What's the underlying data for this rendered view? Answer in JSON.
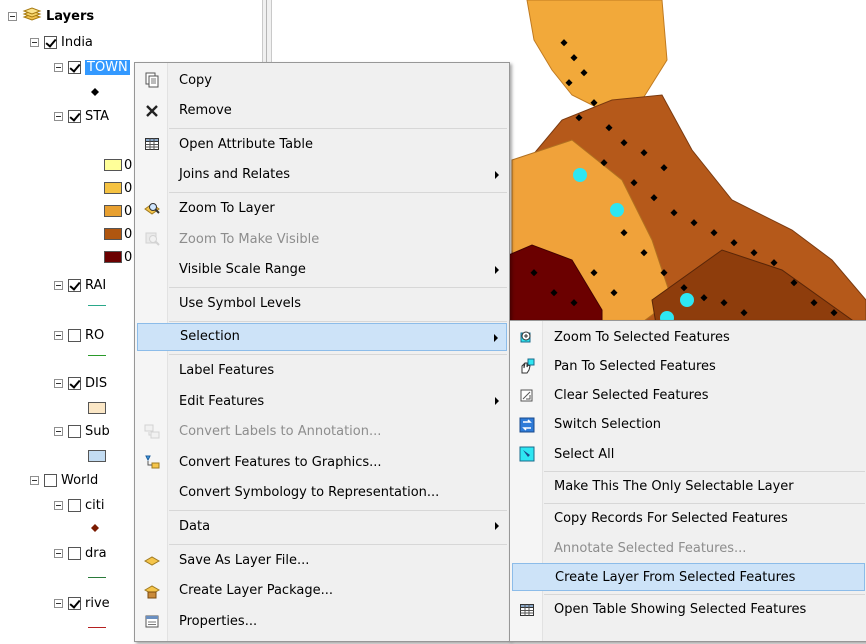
{
  "toc": {
    "root_label": "Layers",
    "india_label": "India",
    "town_label": "TOWN",
    "state_label": "STA",
    "rail_label": "RAI",
    "road_label": "RO",
    "dist_label": "DIS",
    "sub_label": "Sub",
    "world_label": "World",
    "cities_label": "citi",
    "drainage_label": "dra",
    "rivers_label": "rive",
    "class_marker": "0"
  },
  "context_menu": {
    "items": [
      {
        "label": "Copy",
        "icon": "copy-icon"
      },
      {
        "label": "Remove",
        "icon": "remove-icon"
      },
      {
        "label": "Open Attribute Table",
        "icon": "table-icon"
      },
      {
        "label": "Joins and Relates",
        "icon": "",
        "submenu": true
      },
      {
        "label": "Zoom To Layer",
        "icon": "zoom-layer-icon"
      },
      {
        "label": "Zoom To Make Visible",
        "icon": "zoom-visible-icon",
        "disabled": true
      },
      {
        "label": "Visible Scale Range",
        "icon": "",
        "submenu": true
      },
      {
        "label": "Use Symbol Levels",
        "icon": ""
      },
      {
        "label": "Selection",
        "icon": "",
        "submenu": true,
        "highlighted": true
      },
      {
        "label": "Label Features",
        "icon": ""
      },
      {
        "label": "Edit Features",
        "icon": "",
        "submenu": true
      },
      {
        "label": "Convert Labels to Annotation...",
        "icon": "convert-labels-icon",
        "disabled": true
      },
      {
        "label": "Convert Features to Graphics...",
        "icon": "convert-features-icon"
      },
      {
        "label": "Convert Symbology to Representation...",
        "icon": ""
      },
      {
        "label": "Data",
        "icon": "",
        "submenu": true
      },
      {
        "label": "Save As Layer File...",
        "icon": "layer-file-icon"
      },
      {
        "label": "Create Layer Package...",
        "icon": "layer-package-icon"
      },
      {
        "label": "Properties...",
        "icon": "properties-icon"
      }
    ]
  },
  "selection_submenu": {
    "items": [
      {
        "label": "Zoom To Selected Features",
        "icon": "zoom-selected-icon"
      },
      {
        "label": "Pan To Selected Features",
        "icon": "pan-selected-icon"
      },
      {
        "label": "Clear Selected Features",
        "icon": "clear-selection-icon"
      },
      {
        "label": "Switch Selection",
        "icon": "switch-selection-icon"
      },
      {
        "label": "Select All",
        "icon": "select-all-icon"
      },
      {
        "label": "Make This The Only Selectable Layer",
        "icon": ""
      },
      {
        "label": "Copy Records For Selected Features",
        "icon": ""
      },
      {
        "label": "Annotate Selected Features...",
        "icon": "",
        "disabled": true
      },
      {
        "label": "Create Layer From Selected Features",
        "icon": "",
        "highlighted": true
      },
      {
        "label": "Open Table Showing Selected Features",
        "icon": "table-icon"
      }
    ]
  },
  "colors": {
    "selection_blue": "#3399ff",
    "menu_highlight": "#cde3f8",
    "state_class_1": "#ffff99",
    "state_class_2": "#f5c242",
    "state_class_3": "#e8a030",
    "state_class_4": "#b0560f",
    "state_class_5": "#6b0000"
  }
}
